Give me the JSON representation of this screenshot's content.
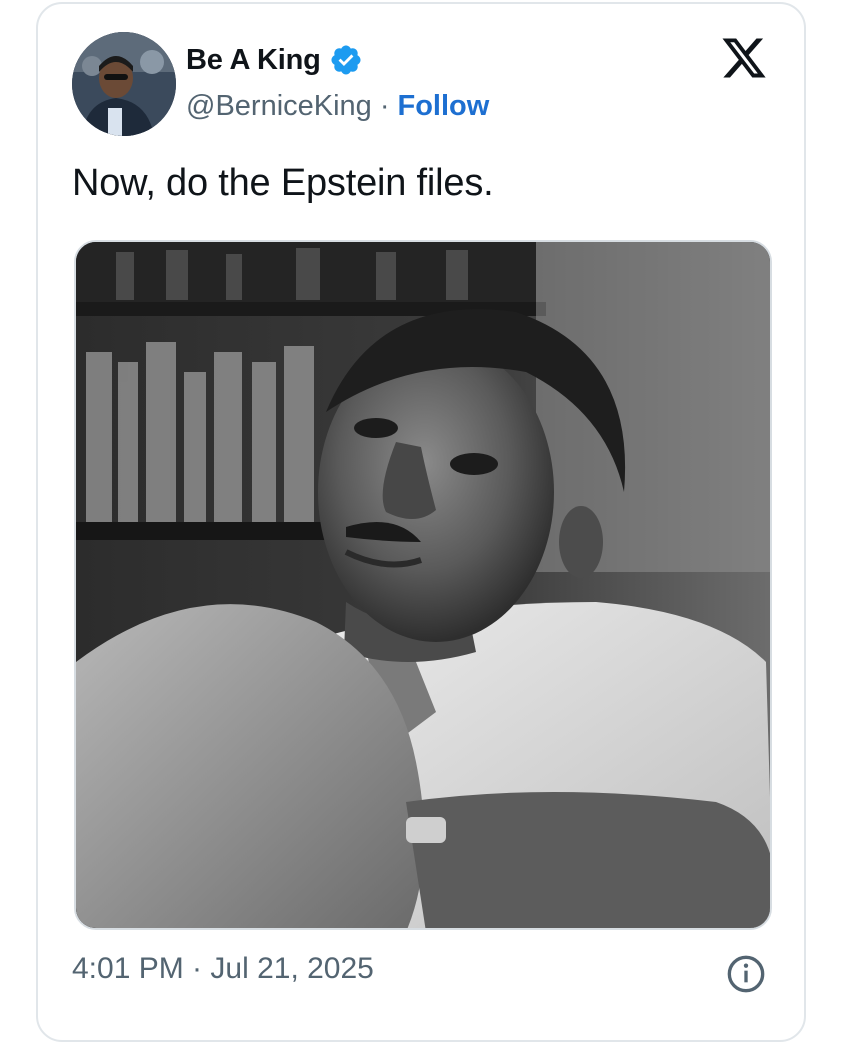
{
  "tweet": {
    "author": {
      "display_name": "Be A King",
      "handle": "@BerniceKing",
      "verified": true,
      "avatar_icon": "profile-photo"
    },
    "separator": "·",
    "follow_label": "Follow",
    "text": "Now, do the Epstein files.",
    "media": {
      "type": "black-and-white photograph"
    },
    "timestamp": "4:01 PM · Jul 21, 2025"
  },
  "icons": {
    "platform_logo": "x-logo-icon",
    "verified": "verified-badge-icon",
    "info": "info-icon"
  },
  "colors": {
    "link_blue": "#1d6fd1",
    "verified_blue": "#1d9bf0",
    "secondary_text": "#536471",
    "primary_text": "#0f1419",
    "border": "#e1e6ea"
  }
}
